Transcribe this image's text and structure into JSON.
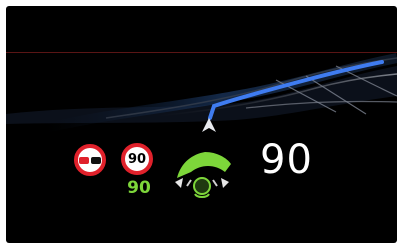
{
  "cluster": {
    "speed_limit_sign": "90",
    "speed_limit_text": "90",
    "current_speed": "90"
  },
  "colors": {
    "background": "#000000",
    "route": "#3f7cf0",
    "sign_ring": "#e0212b",
    "accent_green": "#7dd63a"
  },
  "icons": [
    "no-overtaking-sign-icon",
    "speed-limit-sign-icon",
    "driver-assist-icon",
    "navigation-arrow-icon"
  ]
}
